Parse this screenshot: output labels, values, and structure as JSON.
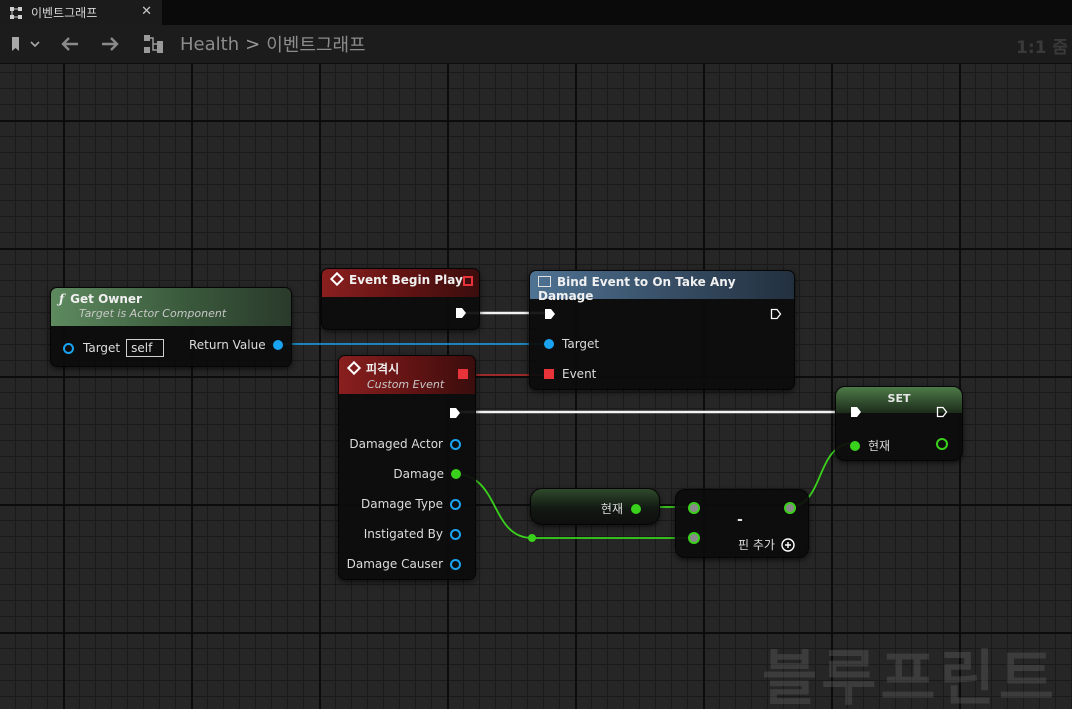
{
  "tab": {
    "title": "이벤트그래프",
    "close": "✕"
  },
  "toolbar": {
    "breadcrumb": [
      "Health",
      "이벤트그래프"
    ],
    "separator": ">",
    "zoom": "1:1 줌"
  },
  "watermark": "블루프린트",
  "nodes": {
    "get_owner": {
      "title": "Get Owner",
      "subtitle": "Target is Actor Component",
      "target_label": "Target",
      "target_value": "self",
      "return_label": "Return Value"
    },
    "begin_play": {
      "title": "Event Begin Play"
    },
    "bind_event": {
      "title": "Bind Event to On Take Any Damage",
      "target_label": "Target",
      "event_label": "Event"
    },
    "custom_event": {
      "title": "피격시",
      "subtitle": "Custom Event",
      "pins": [
        "Damaged Actor",
        "Damage",
        "Damage Type",
        "Instigated By",
        "Damage Causer"
      ]
    },
    "set_node": {
      "title": "SET",
      "var_label": "현재"
    },
    "get_var": {
      "label": "현재"
    },
    "subtract": {
      "op": "-",
      "add_pin": "핀 추가"
    }
  },
  "colors": {
    "object_pin": "#1aa3f0",
    "float_pin": "#3ad11c",
    "delegate_pin": "#e8333a",
    "exec_pin": "#ffffff",
    "function_header": "#3c5c3e",
    "event_header": "#7b1a1a",
    "bind_header": "#3d5870"
  }
}
